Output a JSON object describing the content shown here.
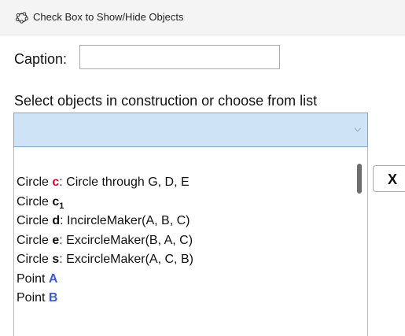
{
  "window": {
    "title": "Check Box to Show/Hide Objects",
    "icon": "geogebra-ring-icon"
  },
  "caption": {
    "label": "Caption:",
    "value": ""
  },
  "selection": {
    "prompt": "Select objects in construction or choose from list",
    "combo_value": "",
    "dropdown_icon": "chevron-down-icon",
    "dropdown_symbol": "⌵"
  },
  "object_list": {
    "items": [
      {
        "type": "Circle ",
        "name": "c",
        "sub": "",
        "color": "#e4002b",
        "desc": ": Circle through G, D, E"
      },
      {
        "type": "Circle ",
        "name": "c",
        "sub": "1",
        "color": "#111111",
        "desc": ""
      },
      {
        "type": "Circle ",
        "name": "d",
        "sub": "",
        "color": "#111111",
        "desc": ": IncircleMaker(A, B, C)"
      },
      {
        "type": "Circle ",
        "name": "e",
        "sub": "",
        "color": "#111111",
        "desc": ": ExcircleMaker(B, A, C)"
      },
      {
        "type": "Circle ",
        "name": "s",
        "sub": "",
        "color": "#111111",
        "desc": ": ExcircleMaker(A, C, B)"
      },
      {
        "type": "Point ",
        "name": "A",
        "sub": "",
        "color": "#3b5bd6",
        "desc": ""
      },
      {
        "type": "Point ",
        "name": "B",
        "sub": "",
        "color": "#3b5bd6",
        "desc": ""
      }
    ]
  },
  "remove_button": {
    "label": "X"
  }
}
